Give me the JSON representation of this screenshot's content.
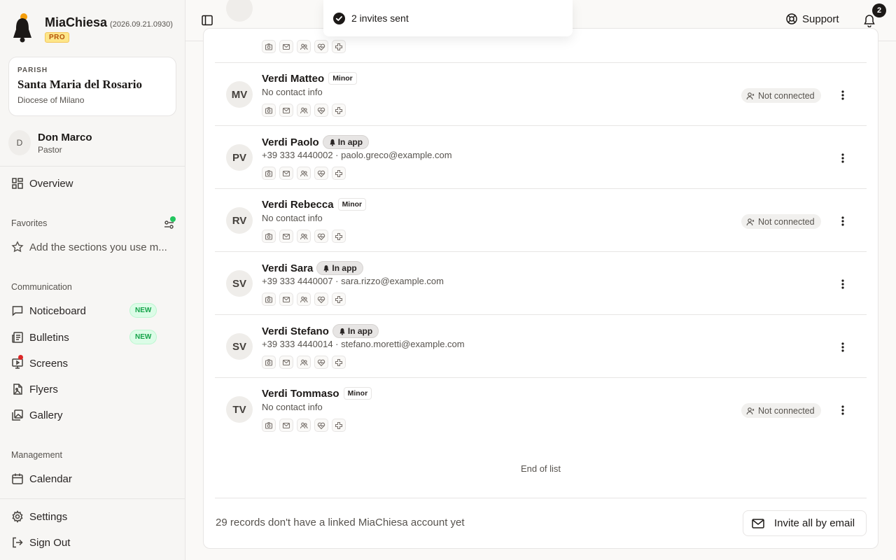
{
  "brand": {
    "name": "MiaChiesa",
    "version": "(2026.09.21.0930)",
    "tier": "PRO"
  },
  "parish": {
    "label": "PARISH",
    "name": "Santa Maria del Rosario",
    "diocese": "Diocese of Milano"
  },
  "user": {
    "initial": "D",
    "name": "Don Marco",
    "role": "Pastor"
  },
  "nav": {
    "overview": "Overview",
    "favorites_title": "Favorites",
    "favorites_hint": "Add the sections you use m...",
    "communication_title": "Communication",
    "noticeboard": "Noticeboard",
    "bulletins": "Bulletins",
    "screens": "Screens",
    "flyers": "Flyers",
    "gallery": "Gallery",
    "management_title": "Management",
    "calendar": "Calendar",
    "settings": "Settings",
    "sign_out": "Sign Out",
    "new_badge": "NEW"
  },
  "header": {
    "support": "Support",
    "notifications_count": "2"
  },
  "toast": {
    "message": "2 invites sent"
  },
  "rows": [
    {
      "initials": "MV",
      "name": "Verdi Matteo",
      "badge": "Minor",
      "contact": "No contact info",
      "status": "Not connected"
    },
    {
      "initials": "PV",
      "name": "Verdi Paolo",
      "badge": "In app",
      "contact": "+39 333 4440002 · paolo.greco@example.com",
      "status": ""
    },
    {
      "initials": "RV",
      "name": "Verdi Rebecca",
      "badge": "Minor",
      "contact": "No contact info",
      "status": "Not connected"
    },
    {
      "initials": "SV",
      "name": "Verdi Sara",
      "badge": "In app",
      "contact": "+39 333 4440007 · sara.rizzo@example.com",
      "status": ""
    },
    {
      "initials": "SV",
      "name": "Verdi Stefano",
      "badge": "In app",
      "contact": "+39 333 4440014 · stefano.moretti@example.com",
      "status": ""
    },
    {
      "initials": "TV",
      "name": "Verdi Tommaso",
      "badge": "Minor",
      "contact": "No contact info",
      "status": "Not connected"
    }
  ],
  "list": {
    "end": "End of list"
  },
  "footer": {
    "unlinked": "29 records don't have a linked MiaChiesa account yet",
    "invite_all": "Invite all by email"
  },
  "colors": {
    "accent": "#f59e0b",
    "new_badge": "#16a34a",
    "alert_dot": "#dc2626",
    "online_dot": "#22c55e"
  }
}
